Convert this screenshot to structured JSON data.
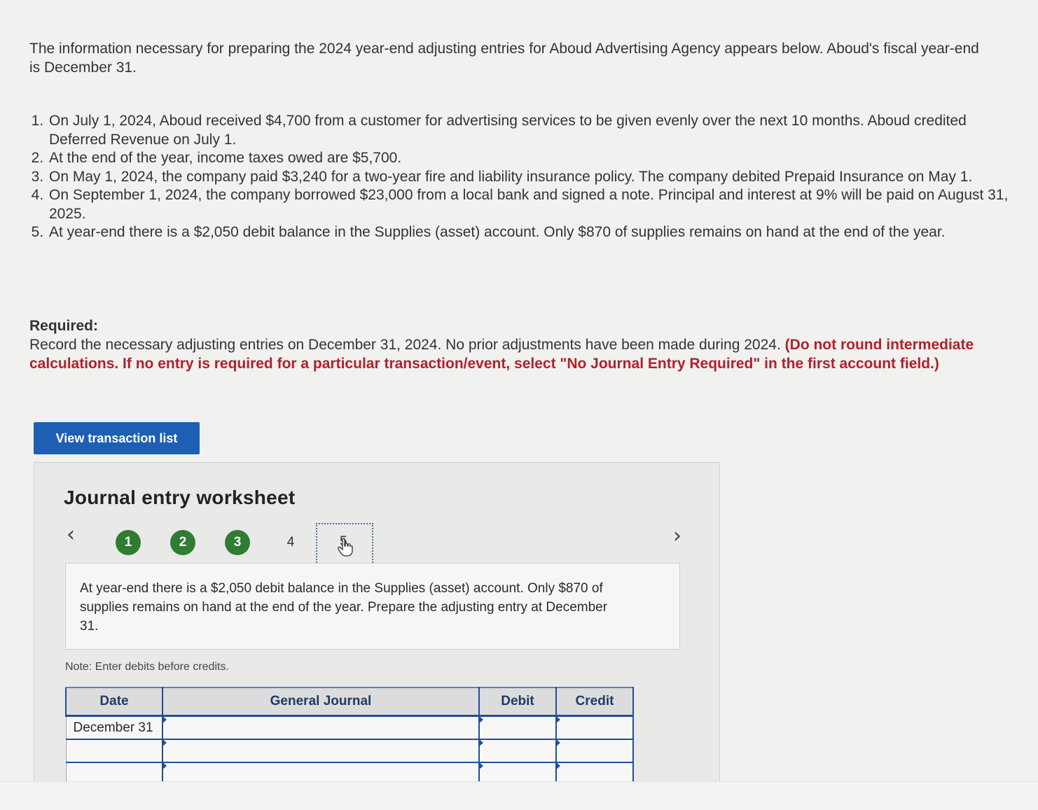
{
  "intro": "The information necessary for preparing the 2024 year-end adjusting entries for Aboud Advertising Agency appears below. Aboud's fiscal year-end is December 31.",
  "items": [
    "On July 1, 2024, Aboud received $4,700 from a customer for advertising services to be given evenly over the next 10 months. Aboud credited Deferred Revenue on July 1.",
    "At the end of the year, income taxes owed are $5,700.",
    "On May 1, 2024, the company paid $3,240 for a two-year fire and liability insurance policy. The company debited Prepaid Insurance on May 1.",
    "On September 1, 2024, the company borrowed $23,000 from a local bank and signed a note. Principal and interest at 9% will be paid on August 31, 2025.",
    "At year-end there is a $2,050 debit balance in the Supplies (asset) account. Only $870 of supplies remains on hand at the end of the year."
  ],
  "required": {
    "label": "Required:",
    "text": "Record the necessary adjusting entries on December 31, 2024. No prior adjustments have been made during 2024.",
    "emphasis": "(Do not round intermediate calculations. If no entry is required for a particular transaction/event, select \"No Journal Entry Required\" in the first account field.)"
  },
  "view_button": "View transaction list",
  "worksheet": {
    "title": "Journal entry worksheet",
    "prev_glyph": "‹",
    "next_glyph": "›",
    "steps": [
      "1",
      "2",
      "3",
      "4",
      "5"
    ],
    "question": "At year-end there is a $2,050 debit balance in the Supplies (asset) account. Only $870 of supplies remains on hand at the end of the year. Prepare the adjusting entry at December 31.",
    "note": "Note: Enter debits before credits.",
    "columns": [
      "Date",
      "General Journal",
      "Debit",
      "Credit"
    ],
    "rows": [
      {
        "date": "December 31",
        "account": "",
        "debit": "",
        "credit": ""
      },
      {
        "date": "",
        "account": "",
        "debit": "",
        "credit": ""
      },
      {
        "date": "",
        "account": "",
        "debit": "",
        "credit": ""
      }
    ]
  },
  "colors": {
    "button_blue": "#1e5fb4",
    "step_done_green": "#2e7d32",
    "emphasis_red": "#b0212b",
    "table_border_blue": "#1f4f99"
  },
  "icons": [
    "chevron-left-icon",
    "chevron-right-icon",
    "hand-pointer-icon"
  ]
}
